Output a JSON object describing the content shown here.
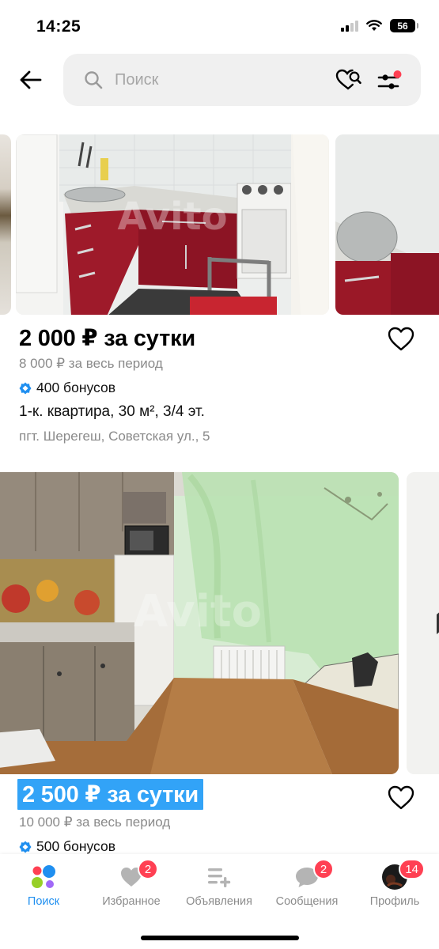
{
  "status_bar": {
    "time": "14:25",
    "battery": "56"
  },
  "header": {
    "back_icon": "arrow-left-icon",
    "search": {
      "placeholder": "Поиск"
    },
    "saved_search_icon": "heart-search-icon",
    "filter_icon": "sliders-icon",
    "filter_dot_color": "#ff4053"
  },
  "listings": [
    {
      "price": "2 000 ₽ за сутки",
      "period_total": "8 000 ₽ за весь период",
      "bonus": "400 бонусов",
      "details": "1-к. квартира, 30 м², 3/4 эт.",
      "address": "пгт. Шерегеш, Советская ул., 5",
      "favorite": false
    },
    {
      "price": "2 500 ₽ за сутки",
      "period_total": "10 000 ₽ за весь период",
      "bonus": "500 бонусов",
      "favorite": false,
      "price_highlighted": true
    }
  ],
  "tab_bar": {
    "tabs": [
      {
        "label": "Поиск",
        "icon": "avito-dots-icon",
        "active": true
      },
      {
        "label": "Избранное",
        "icon": "heart-icon",
        "badge": "2"
      },
      {
        "label": "Объявления",
        "icon": "list-add-icon"
      },
      {
        "label": "Сообщения",
        "icon": "chat-bubble-icon",
        "badge": "2"
      },
      {
        "label": "Профиль",
        "icon": "avatar-icon",
        "badge": "14"
      }
    ]
  },
  "colors": {
    "accent": "#1f8ff0",
    "badge": "#ff4053",
    "highlight": "#32a3f7",
    "bonus_icon": "#1f8ff0"
  }
}
